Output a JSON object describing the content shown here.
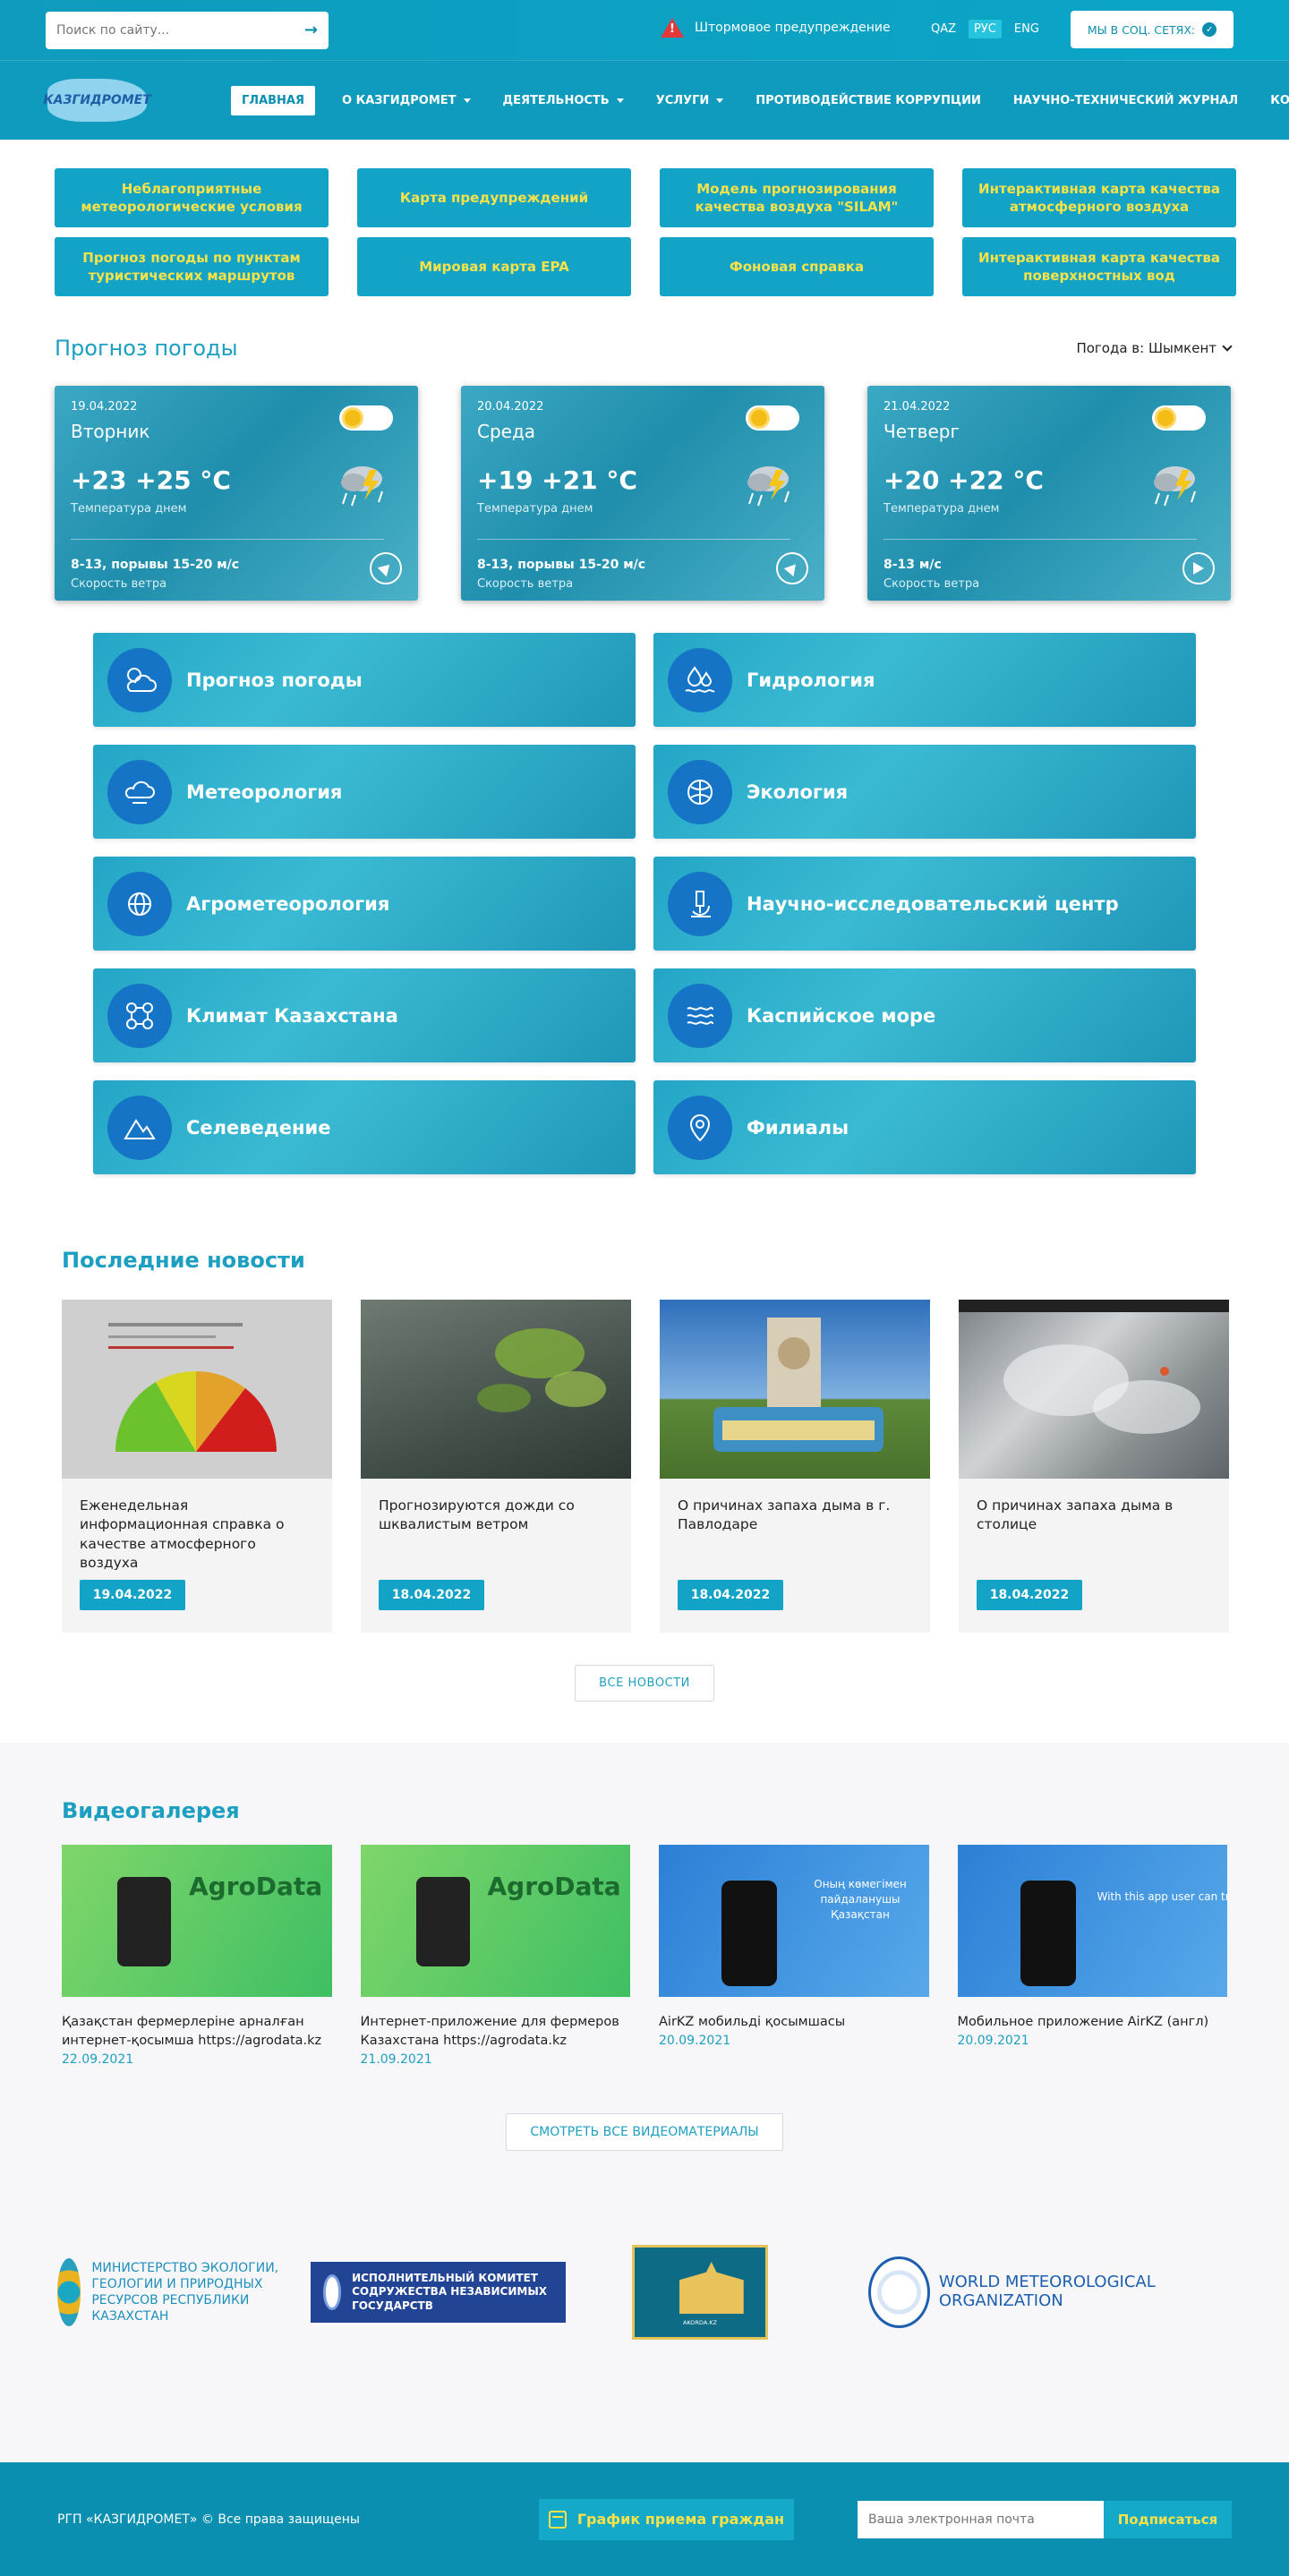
{
  "top": {
    "search_placeholder": "Поиск по сайту...",
    "storm_warning": "Штормовое предупреждение",
    "languages": [
      "QAZ",
      "РУС",
      "ENG"
    ],
    "social_label": "МЫ В СОЦ. СЕТЯХ:"
  },
  "logo": "КАЗГИДРОМЕТ",
  "nav": [
    {
      "label": "ГЛАВНАЯ"
    },
    {
      "label": "О КАЗГИДРОМЕТ"
    },
    {
      "label": "ДЕЯТЕЛЬНОСТЬ"
    },
    {
      "label": "УСЛУГИ"
    },
    {
      "label": "ПРОТИВОДЕЙСТВИЕ КОРРУПЦИИ"
    },
    {
      "label": "НАУЧНО-ТЕХНИЧЕСКИЙ ЖУРНАЛ"
    },
    {
      "label": "КОНТАКТЫ"
    }
  ],
  "quick_links": [
    "Неблагоприятные метеорологические условия",
    "Карта предупреждений",
    "Модель прогнозирования качества воздуха \"SILAM\"",
    "Интерактивная карта качества атмосферного воздуха",
    "Прогноз погоды по пунктам туристических маршрутов",
    "Мировая карта EPA",
    "Фоновая справка",
    "Интерактивная карта качества поверхностных вод"
  ],
  "forecast": {
    "title": "Прогноз погоды",
    "city": "Погода в: Шымкент",
    "days": [
      {
        "date": "19.04.2022",
        "day": "Вторник",
        "temp": "+23 +25 °C",
        "temp_label": "Температура днем",
        "wind": "8-13, порывы 15-20 м/с",
        "wind_label": "Скорость ветра"
      },
      {
        "date": "20.04.2022",
        "day": "Среда",
        "temp": "+19 +21 °C",
        "temp_label": "Температура днем",
        "wind": "8-13, порывы 15-20 м/с",
        "wind_label": "Скорость ветра"
      },
      {
        "date": "21.04.2022",
        "day": "Четверг",
        "temp": "+20 +22 °C",
        "temp_label": "Температура днем",
        "wind": "8-13 м/с",
        "wind_label": "Скорость ветра"
      }
    ]
  },
  "services": [
    "Прогноз погоды",
    "Гидрология",
    "Метеорология",
    "Экология",
    "Агрометеорология",
    "Научно-исследовательский центр",
    "Климат Казахстана",
    "Каспийское море",
    "Селеведение",
    "Филиалы"
  ],
  "news": {
    "title": "Последние новости",
    "items": [
      {
        "title": "Еженедельная информационная справка о качестве атмосферного воздуха",
        "date": "19.04.2022"
      },
      {
        "title": "Прогнозируются дожди со шквалистым ветром",
        "date": "18.04.2022"
      },
      {
        "title": "О причинах запаха дыма в г. Павлодаре",
        "date": "18.04.2022"
      },
      {
        "title": "О причинах запаха дыма в столице",
        "date": "18.04.2022"
      }
    ],
    "all_label": "ВСЕ НОВОСТИ"
  },
  "video": {
    "title": "Видеогалерея",
    "items": [
      {
        "title": "Қазақстан фермерлеріне арналған интернет-қосымша https://agrodata.kz",
        "date": "22.09.2021",
        "thumb_text": "AgroData"
      },
      {
        "title": "Интернет-приложение для фермеров Казахстана https://agrodata.kz",
        "date": "21.09.2021",
        "thumb_text": "AgroData"
      },
      {
        "title": "AirKZ мобильді қосымшасы",
        "date": "20.09.2021",
        "thumb_text": "Оның көмегімен пайдаланушы Қазақстан"
      },
      {
        "title": "Мобильное приложение AirKZ (англ)",
        "date": "20.09.2021",
        "thumb_text": "With this app user can track the qua"
      }
    ],
    "all_label": "СМОТРЕТЬ ВСЕ ВИДЕОМАТЕРИАЛЫ"
  },
  "partners": {
    "ministry": "МИНИСТЕРСТВО ЭКОЛОГИИ, ГЕОЛОГИИ И ПРИРОДНЫХ РЕСУРСОВ РЕСПУБЛИКИ КАЗАХСТАН",
    "cis": "ИСПОЛНИТЕЛЬНЫЙ КОМИТЕТ СОДРУЖЕСТВА НЕЗАВИСИМЫХ ГОСУДАРСТВ",
    "akorda": "AKORDA.KZ",
    "wmo": "WORLD METEOROLOGICAL ORGANIZATION"
  },
  "footer": {
    "copyright": "РГП «КАЗГИДРОМЕТ» © Все права защищены",
    "schedule": "График приема граждан",
    "email_placeholder": "Ваша электронная почта",
    "subscribe": "Подписаться"
  }
}
